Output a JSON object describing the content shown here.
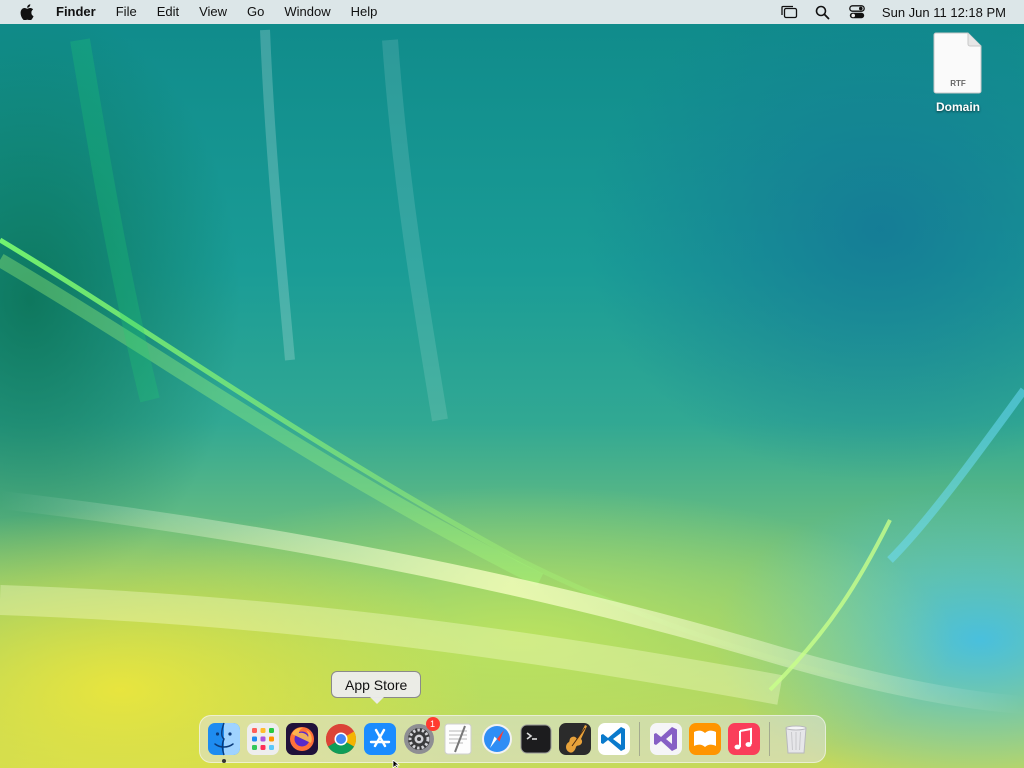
{
  "menubar": {
    "app_name": "Finder",
    "items": [
      "File",
      "Edit",
      "View",
      "Go",
      "Window",
      "Help"
    ],
    "clock": "Sun Jun 11  12:18 PM",
    "status_icons": [
      "stage-manager-icon",
      "spotlight-icon",
      "control-center-icon"
    ]
  },
  "desktop": {
    "file": {
      "name": "Domain",
      "type_label": "RTF"
    }
  },
  "tooltip": {
    "text": "App Store"
  },
  "dock": {
    "apps": [
      {
        "name": "Finder",
        "icon": "finder-icon",
        "running": true
      },
      {
        "name": "Launchpad",
        "icon": "launchpad-icon"
      },
      {
        "name": "Firefox",
        "icon": "firefox-icon"
      },
      {
        "name": "Google Chrome",
        "icon": "chrome-icon"
      },
      {
        "name": "App Store",
        "icon": "app-store-icon"
      },
      {
        "name": "System Settings",
        "icon": "system-settings-icon",
        "badge": "1"
      },
      {
        "name": "TextEdit",
        "icon": "textedit-icon"
      },
      {
        "name": "Safari",
        "icon": "safari-icon"
      },
      {
        "name": "Terminal",
        "icon": "terminal-icon"
      },
      {
        "name": "GarageBand",
        "icon": "garageband-icon"
      },
      {
        "name": "Visual Studio Code",
        "icon": "vscode-icon"
      },
      {
        "name": "Visual Studio",
        "icon": "visual-studio-icon"
      },
      {
        "name": "Books",
        "icon": "books-icon"
      },
      {
        "name": "Music",
        "icon": "music-icon"
      },
      {
        "name": "Trash",
        "icon": "trash-icon"
      }
    ]
  },
  "colors": {
    "menubar_bg": "#eeeef0",
    "badge": "#ff3b30",
    "app_store_blue": "#1a8cff",
    "music_red": "#fa3e5a",
    "books_orange": "#ff9500"
  }
}
